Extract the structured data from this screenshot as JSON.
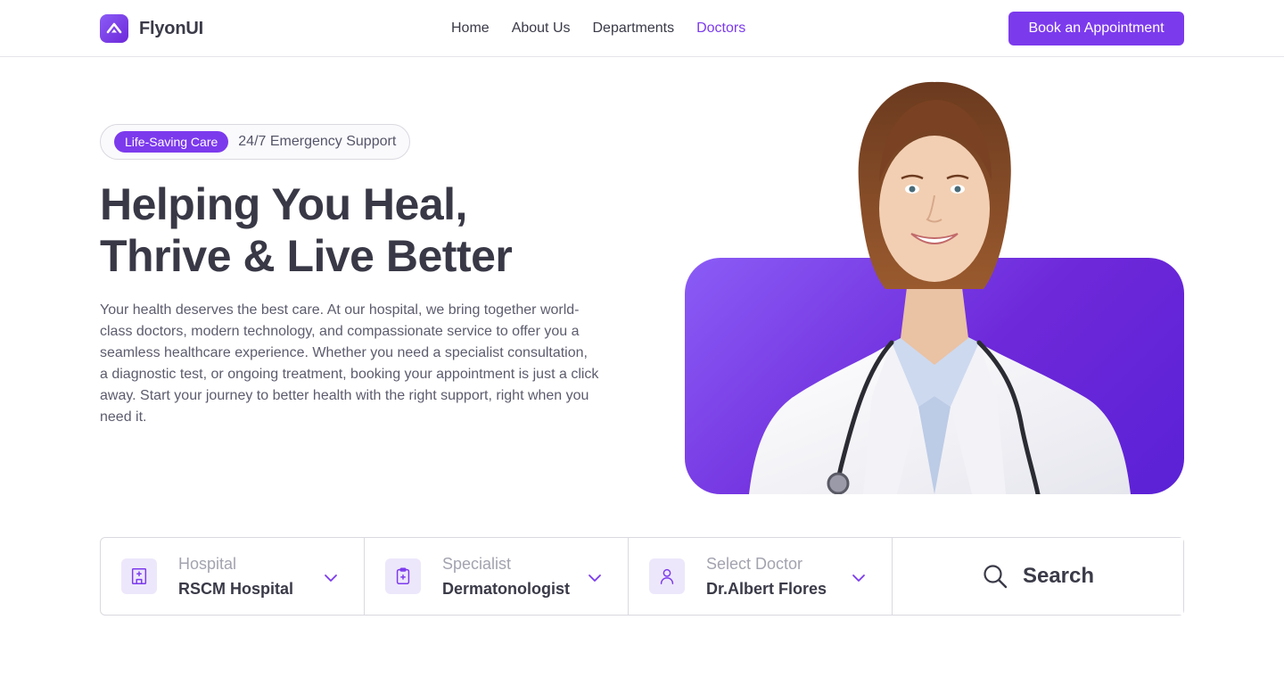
{
  "brand": {
    "name": "FlyonUI"
  },
  "nav": {
    "items": [
      {
        "label": "Home"
      },
      {
        "label": "About Us"
      },
      {
        "label": "Departments"
      },
      {
        "label": "Doctors",
        "active": true
      }
    ]
  },
  "header": {
    "cta_label": "Book an Appointment"
  },
  "hero": {
    "badge": "Life-Saving Care",
    "badge_text": "24/7 Emergency Support",
    "title_line1": "Helping You Heal,",
    "title_line2": "Thrive & Live Better",
    "description": "Your health deserves the best care. At our hospital, we bring together world-class doctors, modern technology, and compassionate service to offer you a seamless healthcare experience. Whether you need a specialist consultation, a diagnostic test, or ongoing treatment, booking your appointment is just a click away. Start your journey to better health with the right support, right when you need it."
  },
  "search": {
    "fields": [
      {
        "label": "Hospital",
        "value": "RSCM Hospital",
        "icon": "hospital-icon"
      },
      {
        "label": "Specialist",
        "value": "Dermatonologist",
        "icon": "clipboard-plus-icon"
      },
      {
        "label": "Select Doctor",
        "value": "Dr.Albert Flores",
        "icon": "user-icon"
      }
    ],
    "button_label": "Search"
  },
  "colors": {
    "accent": "#7c3aed",
    "text": "#3a3a48",
    "muted": "#a3a3b0",
    "icon_bg": "#ede7fb"
  }
}
